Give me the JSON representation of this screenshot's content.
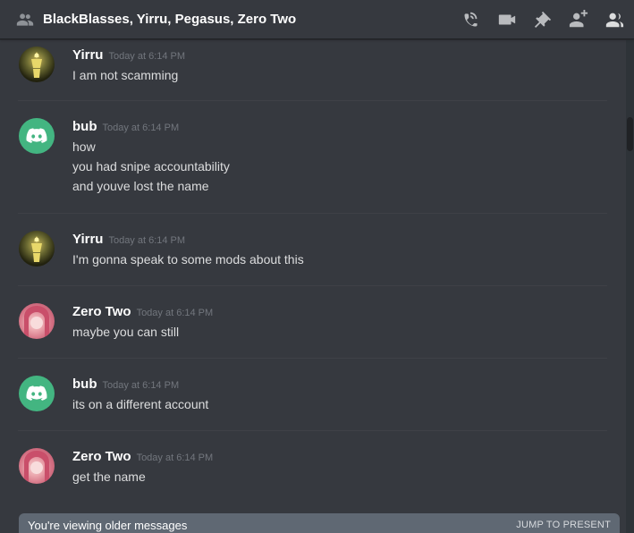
{
  "header": {
    "title": "BlackBlasses, Yirru, Pegasus, Zero Two",
    "icons": [
      "group-dm-icon",
      "call-icon",
      "video-call-icon",
      "pin-icon",
      "add-friend-icon",
      "member-list-icon"
    ]
  },
  "messages": [
    {
      "author": "Yirru",
      "timestamp": "Today at 6:14 PM",
      "avatar": "yirru",
      "lines": [
        "I am not scamming"
      ]
    },
    {
      "author": "bub",
      "timestamp": "Today at 6:14 PM",
      "avatar": "discord-default",
      "lines": [
        "how",
        "you had snipe accountability",
        "and youve lost the name"
      ]
    },
    {
      "author": "Yirru",
      "timestamp": "Today at 6:14 PM",
      "avatar": "yirru",
      "lines": [
        "I'm gonna speak to some mods about this"
      ]
    },
    {
      "author": "Zero Two",
      "timestamp": "Today at 6:14 PM",
      "avatar": "zero-two",
      "lines": [
        "maybe you can still"
      ]
    },
    {
      "author": "bub",
      "timestamp": "Today at 6:14 PM",
      "avatar": "discord-default",
      "lines": [
        "its on a different account"
      ]
    },
    {
      "author": "Zero Two",
      "timestamp": "Today at 6:14 PM",
      "avatar": "zero-two",
      "lines": [
        "get the name"
      ]
    }
  ],
  "older_bar": {
    "text": "You're viewing older messages",
    "jump_label": "JUMP TO PRESENT"
  },
  "colors": {
    "background": "#36393f",
    "discord_green": "#43b581",
    "timestamp": "#72767d"
  }
}
